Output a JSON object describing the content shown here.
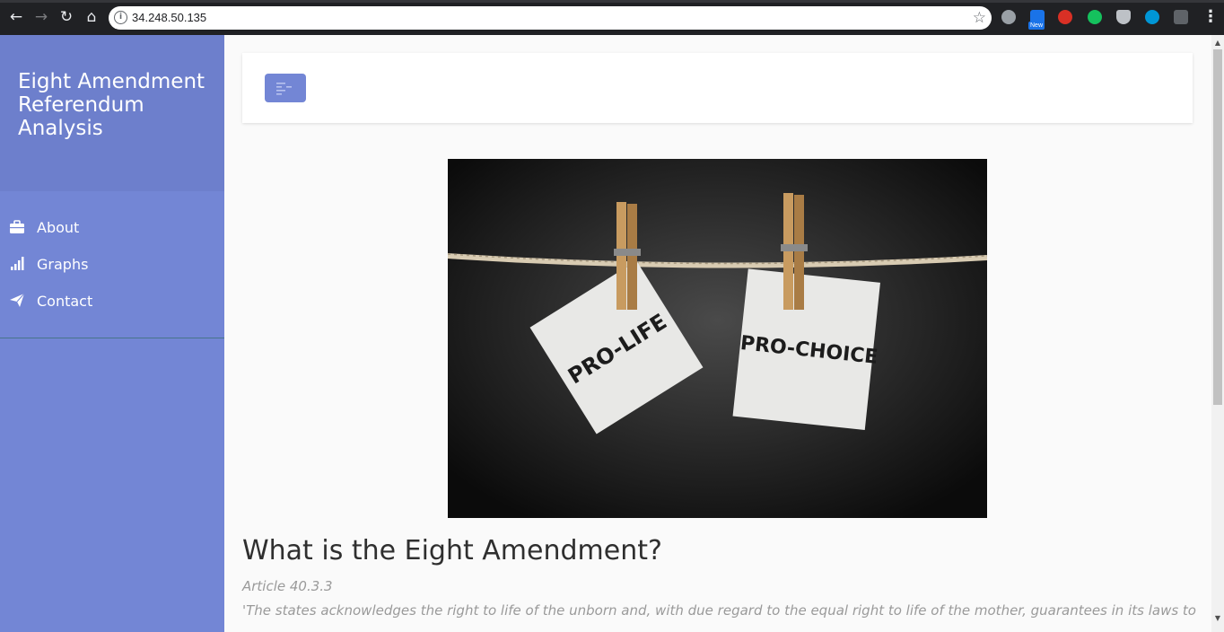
{
  "browser": {
    "url": "34.248.50.135",
    "extension_badge": "New"
  },
  "sidebar": {
    "title": "Eight Amendment Referendum Analysis",
    "items": [
      {
        "label": "About",
        "icon": "briefcase-icon"
      },
      {
        "label": "Graphs",
        "icon": "bar-chart-icon"
      },
      {
        "label": "Contact",
        "icon": "paper-plane-icon"
      }
    ]
  },
  "hero": {
    "left_card": "PRO-LIFE",
    "right_card": "PRO-CHOICE"
  },
  "content": {
    "heading": "What is the Eight Amendment?",
    "article_ref": "Article 40.3.3",
    "quote": "'The states acknowledges the right to life of the unborn and, with due regard to the equal right to life of the mother, guarantees in its laws to"
  },
  "colors": {
    "sidebar": "#7386d5",
    "sidebar_header": "#6d7fcc",
    "accent": "#7386d5"
  }
}
